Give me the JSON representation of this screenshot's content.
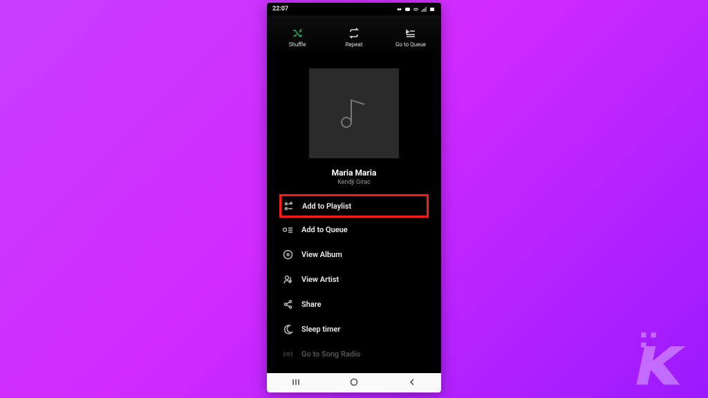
{
  "status": {
    "time": "22:07"
  },
  "top": {
    "shuffle": "Shuffle",
    "repeat": "Repeat",
    "queue": "Go to Queue"
  },
  "track": {
    "title": "Maria Maria",
    "artist": "Kendji Girac"
  },
  "menu": {
    "add_playlist": "Add to Playlist",
    "add_queue": "Add to Queue",
    "view_album": "View Album",
    "view_artist": "View Artist",
    "share": "Share",
    "sleep_timer": "Sleep timer",
    "song_radio": "Go to Song Radio"
  }
}
